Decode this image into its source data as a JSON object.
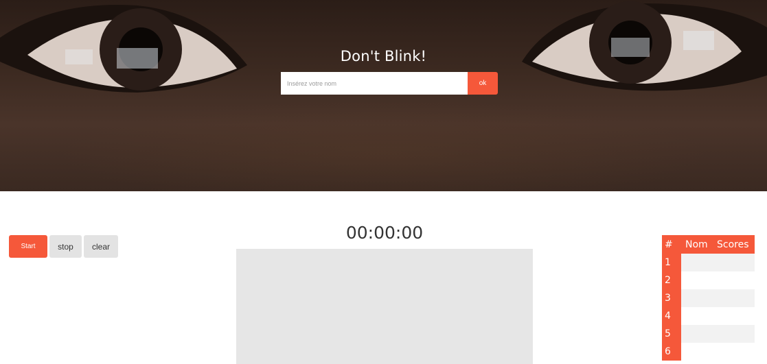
{
  "hero": {
    "title": "Don't Blink!",
    "name_placeholder": "Insérez votre nom",
    "ok_label": "ok"
  },
  "controls": {
    "start_label": "Start",
    "stop_label": "stop",
    "clear_label": "clear"
  },
  "timer": {
    "value": "00:00:00"
  },
  "scoreboard": {
    "headers": [
      "#",
      "Nom",
      "Scores"
    ],
    "rows": [
      {
        "rank": "1",
        "name": "",
        "score": ""
      },
      {
        "rank": "2",
        "name": "",
        "score": ""
      },
      {
        "rank": "3",
        "name": "",
        "score": ""
      },
      {
        "rank": "4",
        "name": "",
        "score": ""
      },
      {
        "rank": "5",
        "name": "",
        "score": ""
      },
      {
        "rank": "6",
        "name": "",
        "score": ""
      }
    ]
  },
  "colors": {
    "accent": "#f5583a",
    "button_neutral": "#e3e3e3",
    "screen_bg": "#e6e6e6"
  }
}
